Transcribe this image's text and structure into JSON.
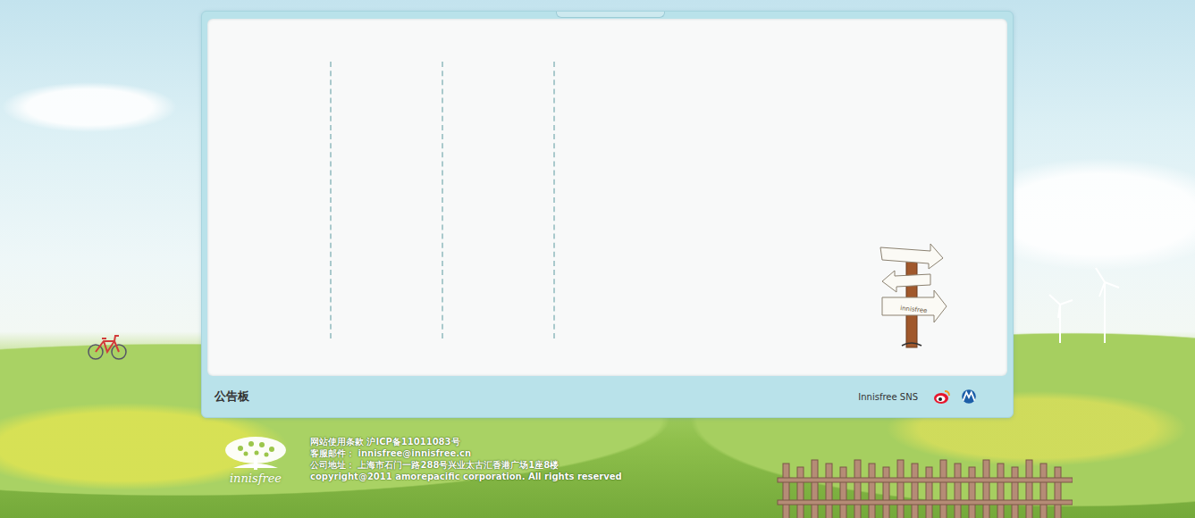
{
  "board": {
    "title": "公告板",
    "sns_label": "Innisfree SNS",
    "sign_label": "innisfree"
  },
  "footer": {
    "logo": "innisfree",
    "lines": [
      "网站使用条款  沪ICP备11011083号",
      "客服邮件： innisfree@innisfree.cn",
      "公司地址： 上海市石门一路288号兴业太古汇香港广场1座8楼",
      "copyright@2011 amorepacific corporation. All rights reserved"
    ]
  }
}
